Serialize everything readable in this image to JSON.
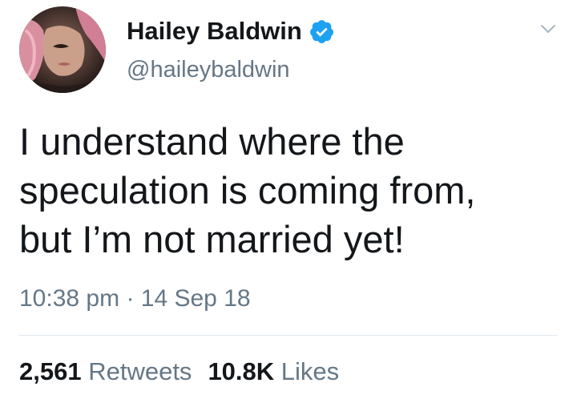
{
  "author": {
    "display_name": "Hailey Baldwin",
    "handle": "@haileybaldwin",
    "verified": true,
    "avatar": "profile-photo"
  },
  "tweet": {
    "text_lines": [
      "I understand where the",
      "speculation is coming from,",
      "but I’m not married yet!"
    ],
    "time": "10:38 pm",
    "separator": "·",
    "date": "14 Sep 18"
  },
  "stats": {
    "retweets_count": "2,561",
    "retweets_label": "Retweets",
    "likes_count": "10.8K",
    "likes_label": "Likes"
  },
  "icons": {
    "verified": "verified-badge-icon",
    "menu": "chevron-down-icon"
  },
  "colors": {
    "verified_blue": "#1da1f2",
    "secondary_text": "#657786",
    "primary_text": "#14171a",
    "divider": "#e1e8ed"
  }
}
